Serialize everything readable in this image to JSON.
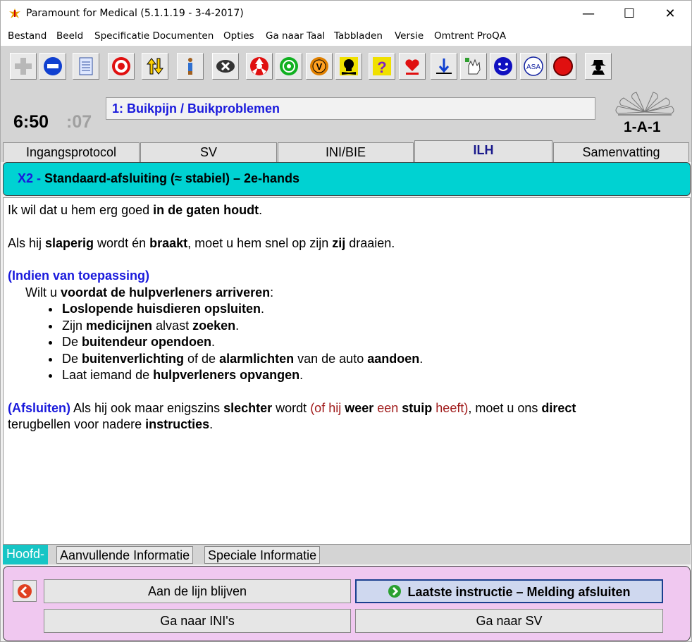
{
  "window": {
    "title": "Paramount for Medical (5.1.1.19 - 3-4-2017)",
    "minimize_icon": "minimize-icon",
    "maximize_icon": "maximize-icon",
    "close_icon": "close-icon"
  },
  "menu": [
    "Bestand",
    "Beeld",
    "Specificatie Documenten",
    "Opties",
    "Ga naar Taal",
    "Tabbladen",
    "Versie",
    "Omtrent ProQA"
  ],
  "toolbar": {
    "icons": [
      "plus-icon",
      "minus-icon",
      "document-icon",
      "target-icon",
      "arrows-icon",
      "person-icon",
      "x-badge-icon",
      "radiation-icon",
      "biohazard-icon",
      "v-badge-icon",
      "skull-icon",
      "question-icon",
      "heart-icon",
      "arrow-down-icon",
      "hand-icon",
      "face-icon",
      "asa-icon",
      "stop-icon",
      "spy-icon"
    ],
    "asa_label": "ASA"
  },
  "header": {
    "clock": "6:50",
    "clock_seconds": ":07",
    "protocol": "1:  Buikpijn / Buikproblemen",
    "code": "1-A-1"
  },
  "tabs": [
    {
      "label": "Ingangsprotocol"
    },
    {
      "label": "SV"
    },
    {
      "label": "INI/BIE"
    },
    {
      "label": "ILH",
      "active": true
    },
    {
      "label": "Samenvatting"
    }
  ],
  "heading": {
    "code": "X2",
    "separator": " - ",
    "title": "Standaard-afsluiting (≈ stabiel) – 2e-hands"
  },
  "content": {
    "p1": {
      "a": "Ik wil dat u hem erg goed ",
      "b": "in de gaten houdt",
      "c": "."
    },
    "p2": {
      "a": "Als hij ",
      "b": "slaperig",
      "c": " wordt én ",
      "d": "braakt",
      "e": ", moet u hem snel op zijn ",
      "f": "zij",
      "g": " draaien."
    },
    "p3_heading": "(Indien van toepassing)",
    "p3_intro": {
      "a": "Wilt u ",
      "b": "voordat de hulpverleners arriveren",
      "c": ":"
    },
    "bullets": [
      {
        "a": "",
        "b": "Loslopende huisdieren opsluiten",
        "c": ".",
        "d": "",
        "e": "",
        "f": ""
      },
      {
        "a": "Zijn ",
        "b": "medicijnen",
        "c": " alvast ",
        "d": "zoeken",
        "e": ".",
        "f": ""
      },
      {
        "a": "De ",
        "b": "buitendeur opendoen",
        "c": ".",
        "d": "",
        "e": "",
        "f": ""
      },
      {
        "a": "De ",
        "b": "buitenverlichting",
        "c": " of de ",
        "d": "alarmlichten",
        "e": " van de auto ",
        "f": "aandoen"
      },
      {
        "a": "Laat iemand de ",
        "b": "hulpverleners opvangen",
        "c": ".",
        "d": "",
        "e": "",
        "f": ""
      }
    ],
    "bullet4_end": ".",
    "p4": {
      "heading": "(Afsluiten)",
      "a": " Als hij ook maar enigszins ",
      "b": "slechter",
      "c": " wordt ",
      "d": "(of hij ",
      "e": "weer",
      "f": " een ",
      "g": "stuip",
      "h": " heeft)",
      "i": ", moet u ons ",
      "j": "direct",
      "k": "terugbellen voor nadere ",
      "l": "instructies",
      "m": "."
    }
  },
  "bottom_tabs": [
    "Hoofd-",
    "Aanvullende Informatie",
    "Speciale Informatie"
  ],
  "actions": {
    "stay_on_line": "Aan de lijn blijven",
    "last_instruction": "Laatste instructie – Melding afsluiten",
    "goto_ini": "Ga naar INI's",
    "goto_sv": "Ga naar SV"
  },
  "colors": {
    "heading_bg": "#00d2d2",
    "panel_bg": "#f0c8f0",
    "link_blue": "#1a1adc",
    "dark_red": "#a01a1a"
  }
}
